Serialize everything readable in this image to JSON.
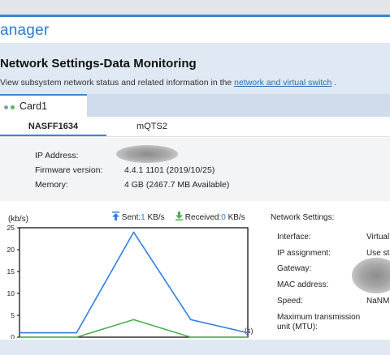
{
  "app": {
    "title": "anager"
  },
  "page": {
    "heading": "Network Settings-Data Monitoring",
    "subtitle_prefix": "View subsystem network status and related information in the ",
    "subtitle_link": "network and virtual switch",
    "subtitle_suffix": " ."
  },
  "card_tab": {
    "label": "Card1",
    "dot_colors": [
      "#8e9aa8",
      "#5cb85c"
    ]
  },
  "sub_tabs": [
    {
      "label": "NASFF1634",
      "active": true
    },
    {
      "label": "mQTS2",
      "active": false
    }
  ],
  "info": {
    "ip_label": "IP Address:",
    "firmware_label": "Firmware version:",
    "firmware_value": "4.4.1 1101 (2019/10/25)",
    "memory_label": "Memory:",
    "memory_value": "4 GB (2467.7 MB Available)"
  },
  "chart_data": {
    "type": "line",
    "ylabel": "(kb/s)",
    "xlabel": "(s)",
    "ylim": [
      0,
      25
    ],
    "yticks": [
      0,
      5,
      10,
      15,
      20,
      25
    ],
    "x": [
      0,
      1,
      2,
      3,
      4
    ],
    "series": [
      {
        "name": "Sent",
        "color": "#2f7fe0",
        "values": [
          1,
          1,
          24,
          4,
          1
        ]
      },
      {
        "name": "Received",
        "color": "#4caf50",
        "values": [
          0,
          0,
          4,
          0,
          0
        ]
      }
    ],
    "legend": {
      "sent_label": "Sent:",
      "sent_value": "1",
      "sent_unit": " KB/s",
      "received_label": "Received:",
      "received_value": "0",
      "received_unit": " KB/s"
    },
    "grid": false
  },
  "network_settings": {
    "heading": "Network Settings:",
    "rows": [
      {
        "label": "Interface:",
        "value": "Virtual"
      },
      {
        "label": "IP assignment:",
        "value": "Use sta"
      },
      {
        "label": "Gateway:",
        "value": ""
      },
      {
        "label": "MAC address:",
        "value": ""
      },
      {
        "label": "Speed:",
        "value": "NaNMB"
      },
      {
        "label": "Maximum transmission unit (MTU):",
        "value": ""
      }
    ]
  }
}
